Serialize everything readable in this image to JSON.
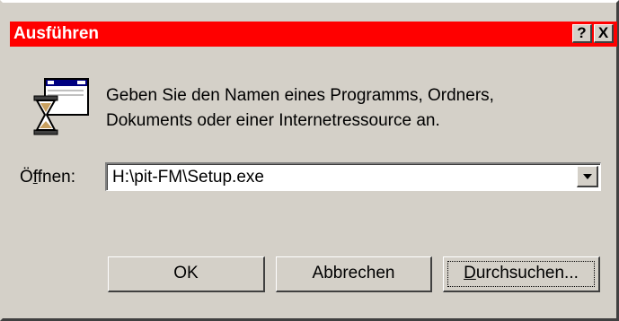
{
  "window": {
    "title": "Ausführen",
    "help_glyph": "?",
    "close_glyph": "X",
    "title_bar_color": "#ff0000",
    "face_color": "#d4d0c8"
  },
  "prompt": {
    "icon": "run-program-hourglass-icon",
    "line1": "Geben Sie den Namen eines Programms, Ordners,",
    "line2": "Dokuments oder einer Internetressource an."
  },
  "open_field": {
    "label_prefix": "Ö",
    "label_underlined": "f",
    "label_suffix": "fnen:",
    "value": "H:\\pit-FM\\Setup.exe"
  },
  "buttons": {
    "ok": "OK",
    "cancel": "Abbrechen",
    "browse_underlined": "D",
    "browse_rest": "urchsuchen..."
  }
}
